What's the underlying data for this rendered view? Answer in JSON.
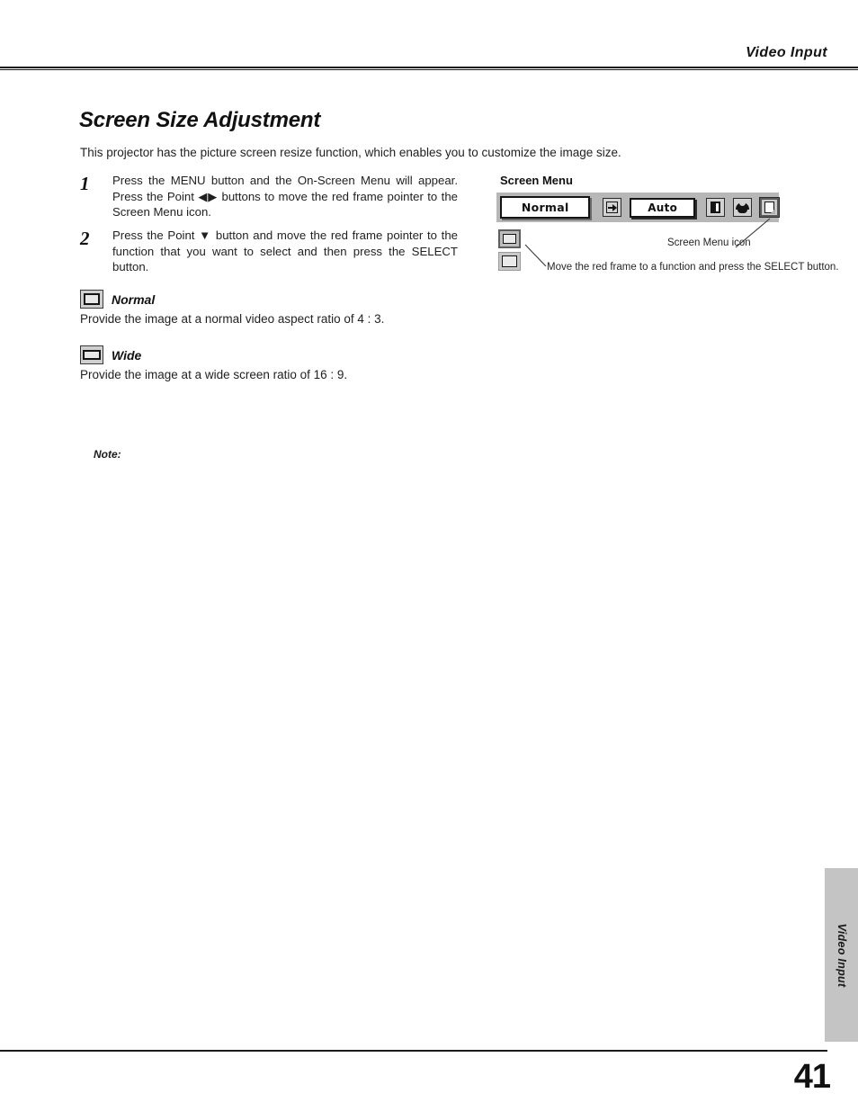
{
  "header": {
    "section_label": "Video Input"
  },
  "page": {
    "title": "Screen Size Adjustment",
    "intro": "This projector has the picture screen resize function, which enables you to customize the image size.",
    "number": "41",
    "side_tab_label": "Video Input"
  },
  "steps": [
    {
      "number": "1",
      "text": "Press the MENU button and the On-Screen Menu will appear.  Press the Point ◀▶ buttons to move the red frame pointer to the Screen Menu icon."
    },
    {
      "number": "2",
      "text": "Press the Point ▼ button and move the red frame pointer to the function that you want to select and then press the SELECT button."
    }
  ],
  "functions": [
    {
      "icon": "screen-normal-icon",
      "label": "Normal",
      "description": "Provide the image at a normal video aspect ratio of 4 : 3."
    },
    {
      "icon": "screen-wide-icon",
      "label": "Wide",
      "description": "Provide the image at a wide screen ratio of 16 : 9."
    }
  ],
  "note": {
    "label": "Note:"
  },
  "illustration": {
    "title": "Screen Menu",
    "menu_bar": {
      "current_value": "Normal",
      "auto_button": "Auto",
      "icons": [
        "resize-arrow-icon",
        "image-adjust-icon",
        "sound-icon",
        "screen-menu-icon"
      ]
    },
    "callouts": [
      "Screen Menu icon",
      "Move the red frame to a function and press the SELECT button."
    ]
  }
}
